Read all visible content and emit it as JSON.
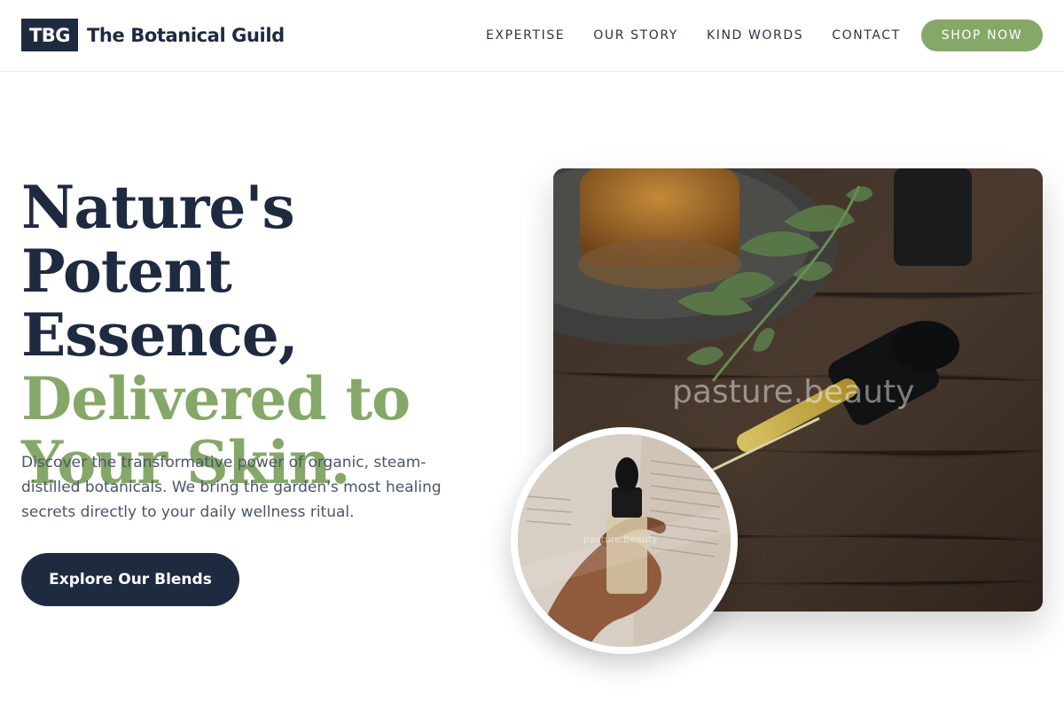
{
  "brand": {
    "mark": "TBG",
    "name": "The Botanical Guild"
  },
  "nav": {
    "items": [
      {
        "label": "EXPERTISE"
      },
      {
        "label": "OUR STORY"
      },
      {
        "label": "KIND WORDS"
      },
      {
        "label": "CONTACT"
      }
    ],
    "shop_label": "SHOP NOW"
  },
  "hero": {
    "headline_line1": "Nature's Potent",
    "headline_line2": "Essence,",
    "headline_line3": "Delivered to",
    "headline_line4": "Your Skin.",
    "description": "Discover the transformative power of organic, steam-distilled botanicals. We bring the garden's most healing secrets directly to your daily wellness ritual.",
    "cta_label": "Explore Our Blends"
  },
  "images": {
    "main_alt_icon": "dropper-bottle-photo",
    "circle_alt_icon": "hand-holding-bottle-photo",
    "watermark_main": "pasture.beauty",
    "watermark_small": "pasture.beauty"
  },
  "colors": {
    "navy": "#1e2a40",
    "sage": "#85a869",
    "body_text": "#4a5568"
  }
}
